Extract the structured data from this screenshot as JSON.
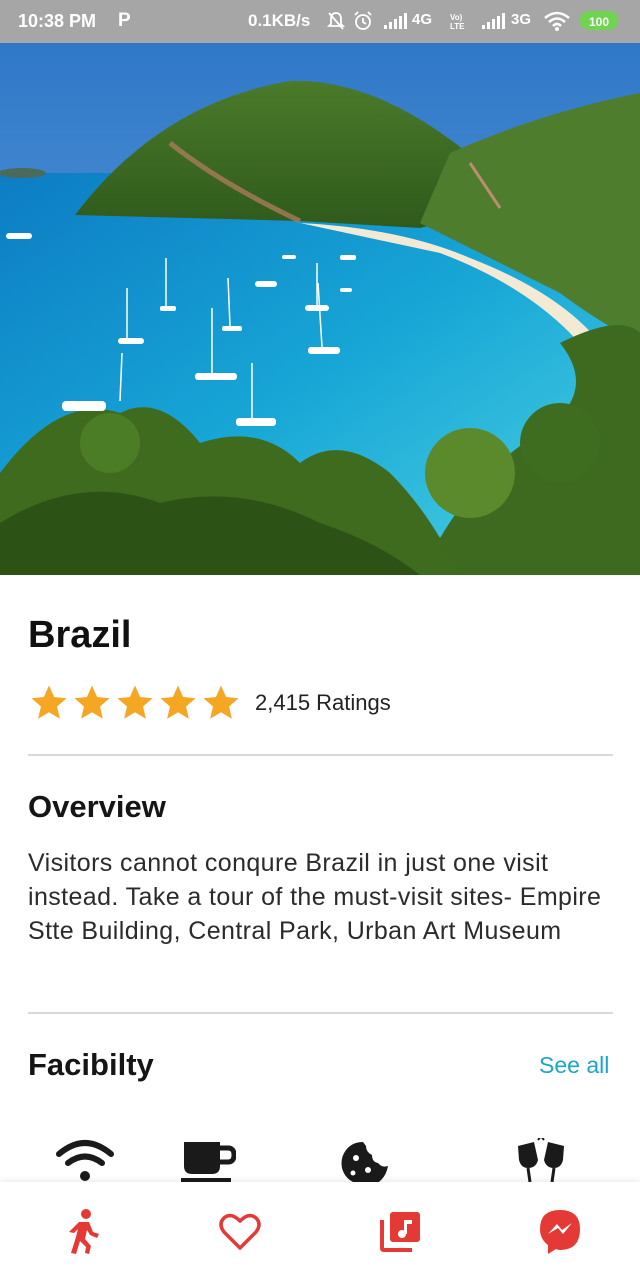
{
  "status_bar": {
    "time": "10:38 PM",
    "p_icon": "P",
    "network_speed": "0.1KB/s",
    "signal_1": "4G",
    "signal_2": "3G",
    "battery": "100"
  },
  "hero": {
    "image": "tropical-bay-photo"
  },
  "place": {
    "title": "Brazil",
    "rating_stars": 5,
    "ratings_label": "2,415 Ratings"
  },
  "overview": {
    "title": "Overview",
    "text": "Visitors cannot conqure Brazil  in just one visit instead. Take a tour of the must-visit sites- Empire Stte Building, Central Park, Urban Art Museum"
  },
  "facility": {
    "title": "Facibilty",
    "see_all_label": "See all",
    "icons": [
      "wifi-icon",
      "coffee-cup-icon",
      "cookie-icon",
      "toast-glasses-icon"
    ]
  },
  "bottom_nav": {
    "items": [
      "walking-person-icon",
      "heart-icon",
      "music-library-icon",
      "messenger-icon"
    ]
  },
  "colors": {
    "star": "#f5a623",
    "accent_red": "#e53935",
    "link": "#1aa7c9",
    "status_bar": "#a6a6a6"
  }
}
